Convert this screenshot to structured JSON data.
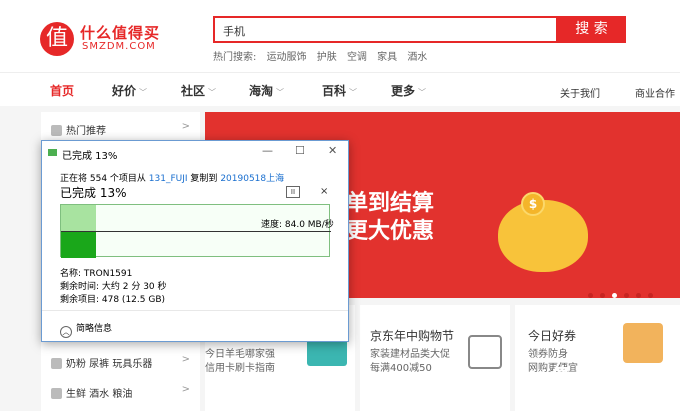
{
  "header": {
    "logo_char": "值",
    "brand_cn": "什么值得买",
    "brand_en": "SMZDM.COM",
    "search_value": "手机",
    "search_button": "搜 索",
    "hot_label": "热门搜索:",
    "hot_items": [
      "运动服饰",
      "护肤",
      "空调",
      "家具",
      "酒水"
    ]
  },
  "nav": {
    "items": [
      {
        "label": "首页",
        "dropdown": false
      },
      {
        "label": "好价",
        "dropdown": true
      },
      {
        "label": "社区",
        "dropdown": true
      },
      {
        "label": "海淘",
        "dropdown": true
      },
      {
        "label": "百科",
        "dropdown": true
      },
      {
        "label": "更多",
        "dropdown": true
      }
    ],
    "right_items": [
      "关于我们",
      "商业合作"
    ]
  },
  "sidebar": {
    "items": [
      {
        "label": "热门推荐",
        "arrow": ">"
      },
      {
        "label": "奶粉  尿裤  玩具乐器",
        "arrow": ">"
      },
      {
        "label": "生鲜  酒水  粮油",
        "arrow": ">"
      }
    ]
  },
  "banner": {
    "text1": "单到结算",
    "text2": "更大优惠",
    "coin": "$",
    "colors": {
      "bg": "#e2322e",
      "accent": "#f8c33a"
    }
  },
  "cards": [
    {
      "title": "",
      "line1": "今日羊毛哪家强",
      "line2": "信用卡刷卡指南"
    },
    {
      "title": "京东年中购物节",
      "line1": "家装建材品类大促",
      "line2": "每满400减50"
    },
    {
      "title": "今日好券",
      "line1": "领券防身",
      "line2": "网购更便宜"
    }
  ],
  "dialog": {
    "title": "已完成 13%",
    "copy_prefix": "正在将 554 个项目从",
    "source": "131_FUJI",
    "copy_mid": "复制到",
    "dest": "20190518上海",
    "progress_label": "已完成 13%",
    "progress": 0.13,
    "pause_glyph": "II",
    "close_glyph": "×",
    "speed": "速度: 84.0 MB/秒",
    "name": "名称: TRON1591",
    "time_left": "剩余时间: 大约 2 分 30 秒",
    "items_left": "剩余项目: 478 (12.5 GB)",
    "less_details": "简略信息",
    "win_min": "—",
    "win_max": "☐",
    "win_close": "✕"
  },
  "watermark": {
    "cn": "值 什么值得买",
    "en": "SMZDM.COM"
  }
}
